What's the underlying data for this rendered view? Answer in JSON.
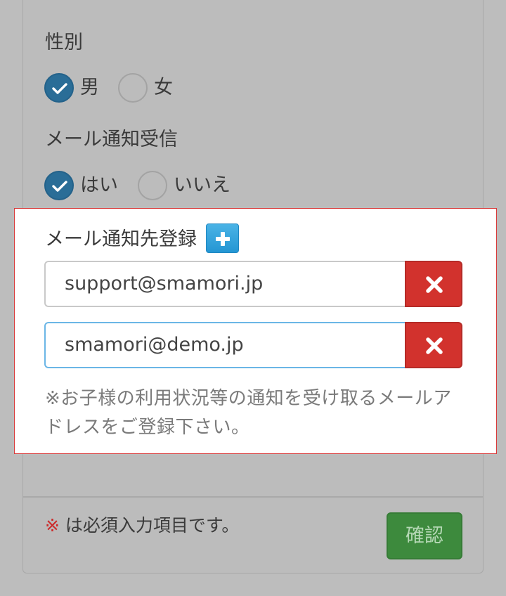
{
  "gender": {
    "label": "性別",
    "options": [
      {
        "label": "男",
        "checked": true
      },
      {
        "label": "女",
        "checked": false
      }
    ]
  },
  "mail_notify": {
    "label": "メール通知受信",
    "options": [
      {
        "label": "はい",
        "checked": true
      },
      {
        "label": "いいえ",
        "checked": false
      }
    ]
  },
  "registration": {
    "label": "メール通知先登録",
    "add_icon": "plus-icon",
    "emails": [
      {
        "value": "support@smamori.jp"
      },
      {
        "value": "smamori@demo.jp"
      }
    ],
    "delete_icon": "close-icon",
    "note": "※お子様の利用状況等の通知を受け取るメールアドレスをご登録下さい。"
  },
  "footer": {
    "required_mark": "※",
    "required_text": " は必須入力項目です。",
    "confirm_label": "確認"
  },
  "colors": {
    "accent_blue": "#2a6d97",
    "add_blue": "#2e9fd9",
    "danger_red": "#d2322d",
    "confirm_green": "#3d8a3d",
    "highlight_border": "#d83a3a"
  }
}
